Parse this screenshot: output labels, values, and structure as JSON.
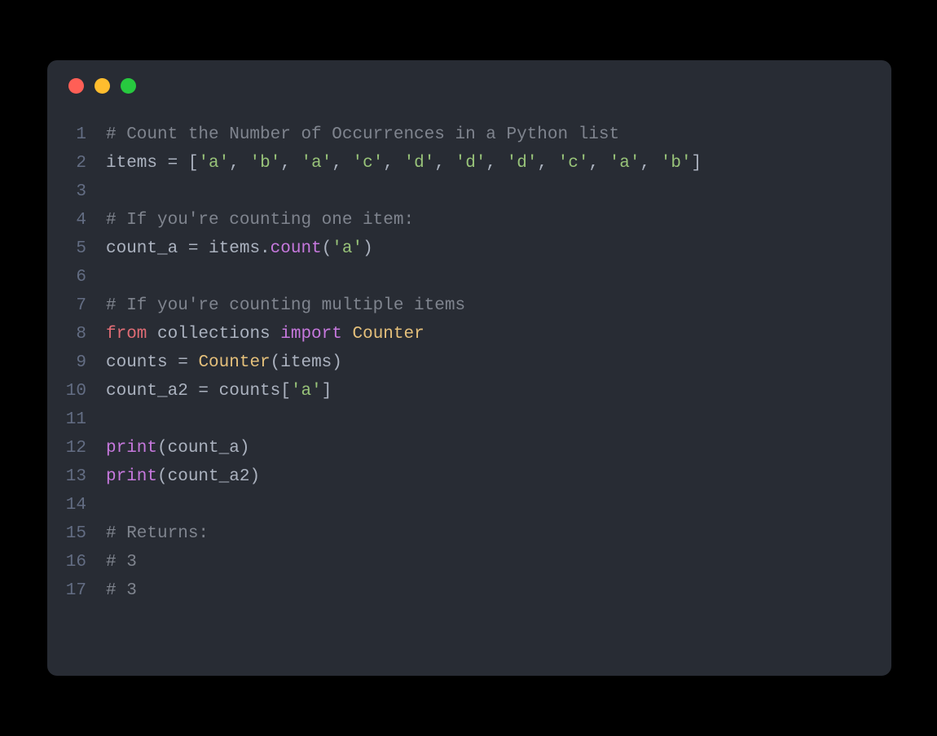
{
  "colors": {
    "bg": "#282c34",
    "dot_red": "#ff5f56",
    "dot_yellow": "#ffbd2e",
    "dot_green": "#27c93f",
    "comment": "#7f848e",
    "keyword": "#c678dd",
    "class": "#e5c07b",
    "string": "#98c379",
    "default": "#abb2bf",
    "gutter": "#636d83",
    "from": "#e06c75"
  },
  "lines": [
    {
      "n": "1",
      "t": [
        [
          "cm",
          "# Count the Number of Occurrences in a Python list"
        ]
      ]
    },
    {
      "n": "2",
      "t": [
        [
          "nm",
          "items "
        ],
        [
          "op",
          "= "
        ],
        [
          "op",
          "["
        ],
        [
          "st",
          "'a'"
        ],
        [
          "op",
          ", "
        ],
        [
          "st",
          "'b'"
        ],
        [
          "op",
          ", "
        ],
        [
          "st",
          "'a'"
        ],
        [
          "op",
          ", "
        ],
        [
          "st",
          "'c'"
        ],
        [
          "op",
          ", "
        ],
        [
          "st",
          "'d'"
        ],
        [
          "op",
          ", "
        ],
        [
          "st",
          "'d'"
        ],
        [
          "op",
          ", "
        ],
        [
          "st",
          "'d'"
        ],
        [
          "op",
          ", "
        ],
        [
          "st",
          "'c'"
        ],
        [
          "op",
          ", "
        ],
        [
          "st",
          "'a'"
        ],
        [
          "op",
          ", "
        ],
        [
          "st",
          "'b'"
        ],
        [
          "op",
          "]"
        ]
      ]
    },
    {
      "n": "3",
      "t": [
        [
          "nm",
          ""
        ]
      ]
    },
    {
      "n": "4",
      "t": [
        [
          "cm",
          "# If you're counting one item:"
        ]
      ]
    },
    {
      "n": "5",
      "t": [
        [
          "nm",
          "count_a "
        ],
        [
          "op",
          "= "
        ],
        [
          "nm",
          "items."
        ],
        [
          "fn",
          "count"
        ],
        [
          "op",
          "("
        ],
        [
          "st",
          "'a'"
        ],
        [
          "op",
          ")"
        ]
      ]
    },
    {
      "n": "6",
      "t": [
        [
          "nm",
          ""
        ]
      ]
    },
    {
      "n": "7",
      "t": [
        [
          "cm",
          "# If you're counting multiple items"
        ]
      ]
    },
    {
      "n": "8",
      "t": [
        [
          "im",
          "from"
        ],
        [
          "nm",
          " collections "
        ],
        [
          "kw",
          "import"
        ],
        [
          "nm",
          " "
        ],
        [
          "cl",
          "Counter"
        ]
      ]
    },
    {
      "n": "9",
      "t": [
        [
          "nm",
          "counts "
        ],
        [
          "op",
          "= "
        ],
        [
          "cl",
          "Counter"
        ],
        [
          "op",
          "("
        ],
        [
          "nm",
          "items"
        ],
        [
          "op",
          ")"
        ]
      ]
    },
    {
      "n": "10",
      "t": [
        [
          "nm",
          "count_a2 "
        ],
        [
          "op",
          "= "
        ],
        [
          "nm",
          "counts"
        ],
        [
          "op",
          "["
        ],
        [
          "st",
          "'a'"
        ],
        [
          "op",
          "]"
        ]
      ]
    },
    {
      "n": "11",
      "t": [
        [
          "nm",
          ""
        ]
      ]
    },
    {
      "n": "12",
      "t": [
        [
          "fn",
          "print"
        ],
        [
          "op",
          "("
        ],
        [
          "nm",
          "count_a"
        ],
        [
          "op",
          ")"
        ]
      ]
    },
    {
      "n": "13",
      "t": [
        [
          "fn",
          "print"
        ],
        [
          "op",
          "("
        ],
        [
          "nm",
          "count_a2"
        ],
        [
          "op",
          ")"
        ]
      ]
    },
    {
      "n": "14",
      "t": [
        [
          "nm",
          ""
        ]
      ]
    },
    {
      "n": "15",
      "t": [
        [
          "cm",
          "# Returns:"
        ]
      ]
    },
    {
      "n": "16",
      "t": [
        [
          "cm",
          "# 3"
        ]
      ]
    },
    {
      "n": "17",
      "t": [
        [
          "cm",
          "# 3"
        ]
      ]
    }
  ]
}
